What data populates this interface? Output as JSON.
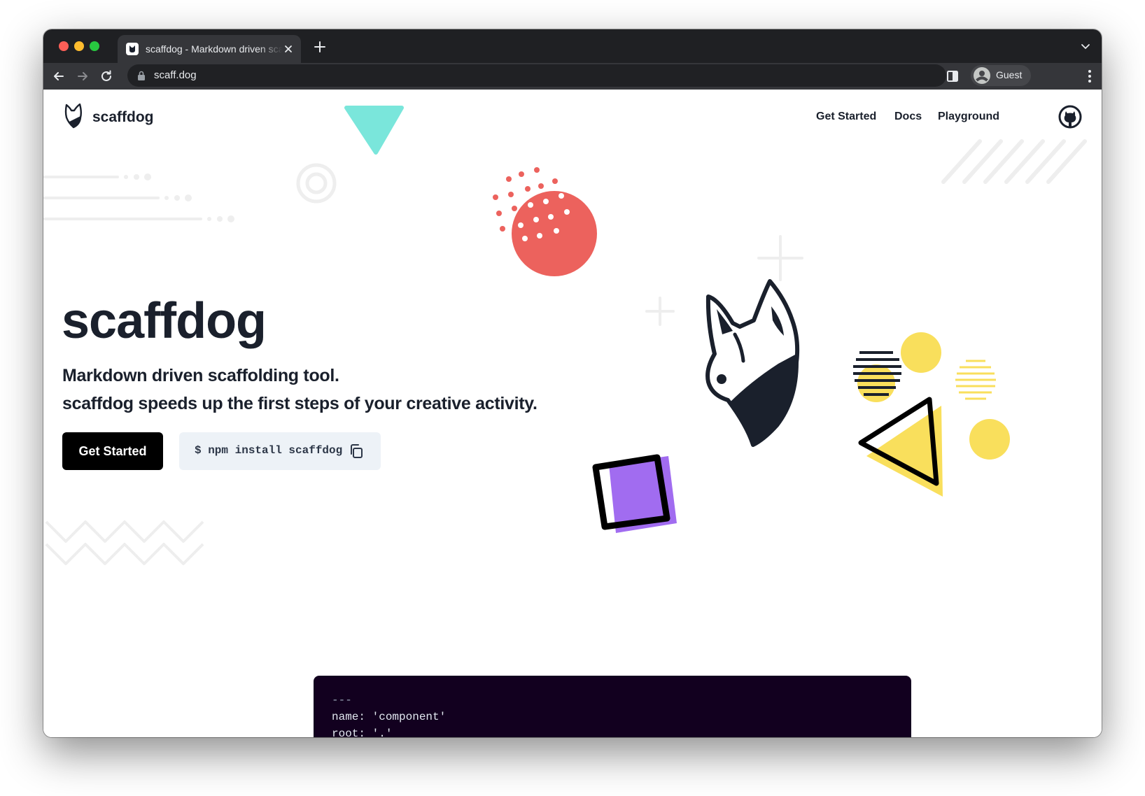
{
  "browser": {
    "tab": {
      "title": "scaffdog - Markdown driven scaffolding tool"
    },
    "address_bar": {
      "url": "scaff.dog"
    },
    "profile": {
      "name": "Guest"
    }
  },
  "site": {
    "brand": "scaffdog",
    "nav": [
      {
        "label": "Get Started"
      },
      {
        "label": "Docs"
      },
      {
        "label": "Playground"
      }
    ]
  },
  "hero": {
    "title": "scaffdog",
    "tagline_1": "Markdown driven scaffolding tool.",
    "tagline_2": "scaffdog speeds up the first steps of your creative activity.",
    "cta_label": "Get Started",
    "install_command": "$ npm install scaffdog"
  },
  "code_preview": {
    "lines": [
      "---",
      "name: 'component'",
      "root: '.'"
    ]
  },
  "colors": {
    "coral": "#ec625d",
    "teal": "#7ae6db",
    "purple": "#a16cf0",
    "yellow": "#f9df5c",
    "ink": "#1a202c",
    "code_bg": "#12001f"
  }
}
